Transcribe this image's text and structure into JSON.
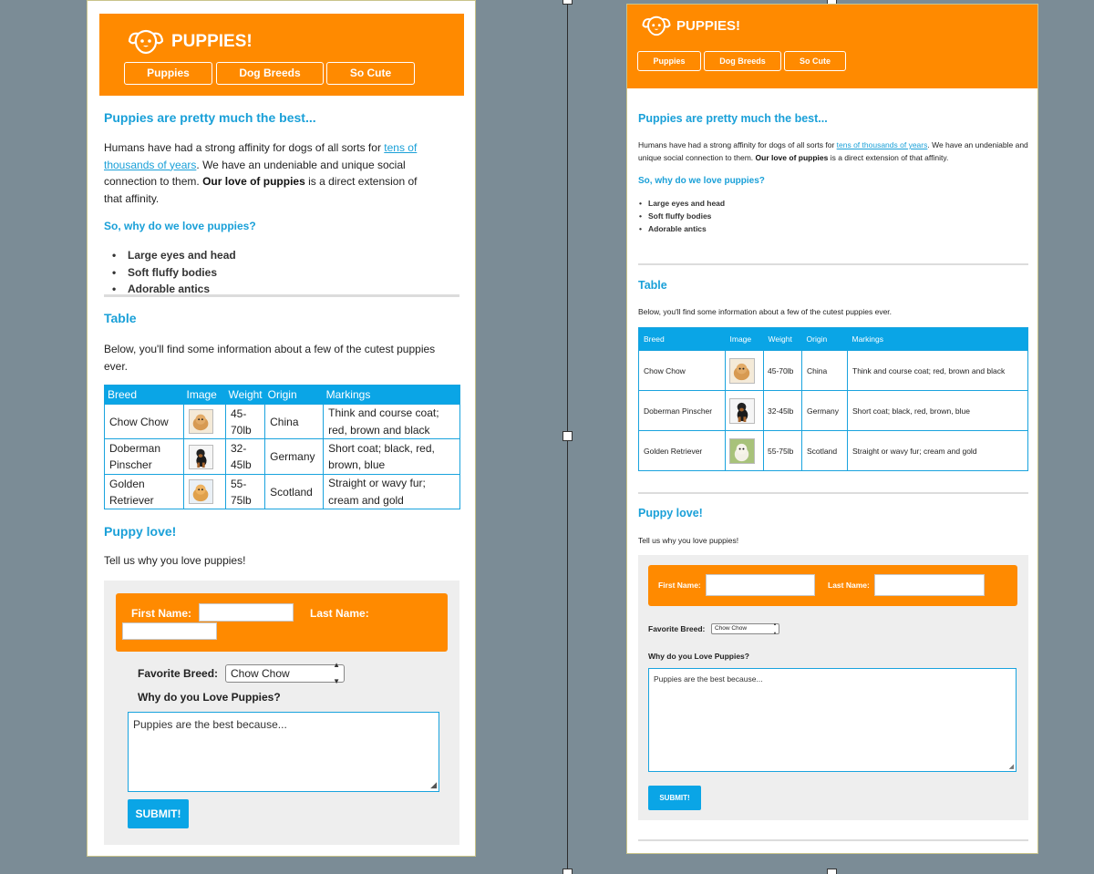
{
  "colors": {
    "orange": "#ff8a00",
    "blue": "#1aa0d8",
    "backdrop": "#7b8c96",
    "form_bg": "#eeeeee"
  },
  "brand": {
    "name": "PUPPIES!",
    "logo_icon": "dog-face-icon"
  },
  "nav": [
    "Puppies",
    "Dog Breeds",
    "So Cute"
  ],
  "intro": {
    "heading": "Puppies are pretty much the best...",
    "p_start": "Humans have had a strong affinity for dogs of all sorts for ",
    "link": "tens of thousands of years",
    "p_mid": ". We have an undeniable and unique social connection to them. ",
    "bold": "Our love of puppies",
    "p_end": " is a direct extension of that affinity."
  },
  "why": {
    "heading": "So, why do we love puppies?",
    "items": [
      "Large eyes and head",
      "Soft fluffy bodies",
      "Adorable antics"
    ]
  },
  "table_section": {
    "heading": "Table",
    "intro": "Below, you'll find some information about a few of the cutest puppies ever.",
    "headers": [
      "Breed",
      "Image",
      "Weight",
      "Origin",
      "Markings"
    ],
    "rows": [
      {
        "breed": "Chow Chow",
        "weight": "45-70lb",
        "origin": "China",
        "markings": "Think and course coat; red, brown and black"
      },
      {
        "breed": "Doberman Pinscher",
        "weight": "32-45lb",
        "origin": "Germany",
        "markings": "Short coat; black, red, brown, blue"
      },
      {
        "breed": "Golden Retriever",
        "weight": "55-75lb",
        "origin": "Scotland",
        "markings": "Straight or wavy fur; cream and gold"
      }
    ]
  },
  "puppy_love": {
    "heading": "Puppy love!",
    "intro": "Tell us why you love puppies!"
  },
  "form": {
    "first_name_label": "First Name:",
    "last_name_label": "Last Name:",
    "favorite_breed_label": "Favorite Breed:",
    "favorite_breed_value": "Chow Chow",
    "why_label": "Why do you Love Puppies?",
    "textarea_placeholder": "Puppies are the best because...",
    "submit_label": "SUBMIT!"
  }
}
